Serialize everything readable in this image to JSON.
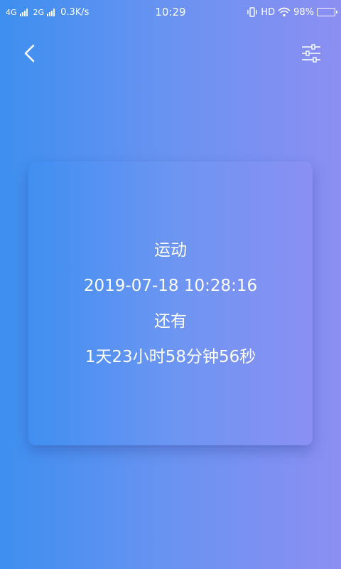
{
  "status_bar": {
    "net1": "4G",
    "net2": "2G",
    "speed": "0.3K/s",
    "time": "10:29",
    "hd": "HD",
    "battery_percent": "98%",
    "battery_level": 98
  },
  "header": {
    "back_icon": "chevron-left-icon",
    "settings_icon": "sliders-icon"
  },
  "card": {
    "event_name": "运动",
    "datetime": "2019-07-18 10:28:16",
    "remaining_label": "还有",
    "countdown": "1天23小时58分钟56秒"
  },
  "colors": {
    "gradient_start": "#3d8ff0",
    "gradient_end": "#8b8ff2",
    "text": "#ffffff"
  }
}
